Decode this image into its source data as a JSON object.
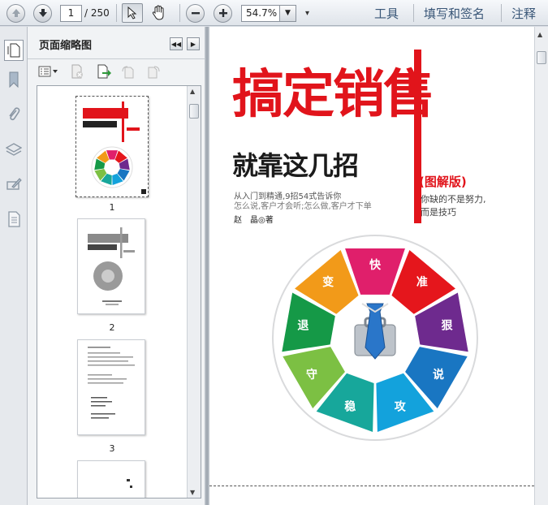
{
  "toolbar": {
    "page_current": "1",
    "page_total": "/ 250",
    "zoom_value": "54.7%",
    "menu_tools": "工具",
    "menu_fill_sign": "填写和签名",
    "menu_comment": "注释"
  },
  "panel": {
    "title": "页面缩略图",
    "thumbnails": [
      {
        "number": "1"
      },
      {
        "number": "2"
      },
      {
        "number": "3"
      }
    ]
  },
  "cover": {
    "title": "搞定销售",
    "subtitle": "就靠这几招",
    "edition_tag": "(图解版)",
    "tagline_1": "你缺的不是努力,",
    "tagline_2": "而是技巧",
    "intro_1": "从入门到精通,9招54式告诉你",
    "intro_2": "怎么说,客户才会听;怎么做,客户才下单",
    "author": "赵　晶◎著",
    "wheel_segments": [
      "快",
      "准",
      "狠",
      "说",
      "攻",
      "稳",
      "守",
      "退",
      "变"
    ],
    "wheel_colors": [
      "#e01f6b",
      "#e5161c",
      "#6e2a8e",
      "#1976c2",
      "#13a2dc",
      "#17a79b",
      "#7cc043",
      "#159947",
      "#f29a19"
    ]
  },
  "icons": {
    "left_strip": [
      "bookmark-icon",
      "attachment-icon",
      "layers-icon",
      "signature-icon",
      "page-icon"
    ]
  }
}
